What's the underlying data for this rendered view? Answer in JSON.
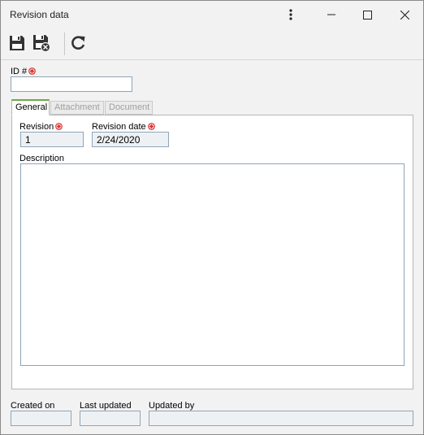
{
  "window": {
    "title": "Revision data"
  },
  "toolbar": {
    "save": "save-icon",
    "save_close": "save-close-icon",
    "refresh": "refresh-icon"
  },
  "form": {
    "id_label": "ID #",
    "id_value": "",
    "tabs": [
      {
        "label": "General",
        "active": true
      },
      {
        "label": "Attachment",
        "active": false
      },
      {
        "label": "Document",
        "active": false
      }
    ],
    "revision_label": "Revision",
    "revision_value": "1",
    "revision_date_label": "Revision date",
    "revision_date_value": "2/24/2020",
    "description_label": "Description",
    "description_value": ""
  },
  "footer": {
    "created_on_label": "Created on",
    "created_on_value": "",
    "last_updated_label": "Last updated",
    "last_updated_value": "",
    "updated_by_label": "Updated by",
    "updated_by_value": ""
  },
  "colors": {
    "required": "#d9302c",
    "active_tab": "#6aaa45",
    "field_border": "#8fa5b8"
  }
}
